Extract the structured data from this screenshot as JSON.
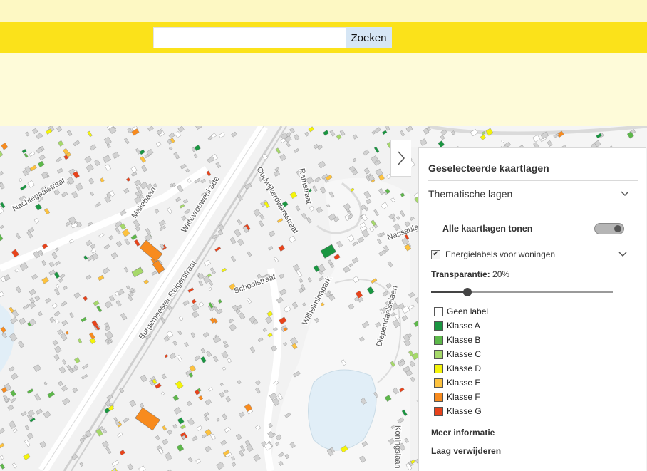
{
  "search": {
    "placeholder": "",
    "value": "",
    "button_label": "Zoeken"
  },
  "colors": {
    "top_band": "#fdf8c3",
    "search_bar": "#fbe21a",
    "blank_area": "#fefbd9",
    "search_button": "#d6e6f5"
  },
  "map": {
    "street_labels": [
      "Maliebaan",
      "Nachtegaalstraat",
      "Oudwijkerdwarsstraat",
      "Burgemeester Reigerstraat",
      "Wittevrouwenkade",
      "Wilhelminapark",
      "Koningslaan",
      "Diependaalselaan",
      "Nassaulaan",
      "Ramstraat",
      "Schoolstraat"
    ]
  },
  "panel": {
    "collapse_icon": "chevron-right-icon",
    "title": "Geselecteerde kaartlagen",
    "section_title": "Thematische lagen",
    "show_all_label": "Alle kaartlagen tonen",
    "show_all_on": true,
    "layer": {
      "checked": true,
      "name": "Energielabels voor woningen"
    },
    "transparency_label": "Transparantie:",
    "transparency_value": "20%",
    "transparency_fraction": 0.2,
    "legend": [
      {
        "label": "Geen label",
        "color": "#ffffff"
      },
      {
        "label": "Klasse A",
        "color": "#1a9641"
      },
      {
        "label": "Klasse B",
        "color": "#5db84a"
      },
      {
        "label": "Klasse C",
        "color": "#a6d96a"
      },
      {
        "label": "Klasse D",
        "color": "#f4f40a"
      },
      {
        "label": "Klasse E",
        "color": "#fdc23e"
      },
      {
        "label": "Klasse F",
        "color": "#f88b1e"
      },
      {
        "label": "Klasse G",
        "color": "#e8431b"
      }
    ],
    "more_info_label": "Meer informatie",
    "remove_layer_label": "Laag verwijderen"
  }
}
